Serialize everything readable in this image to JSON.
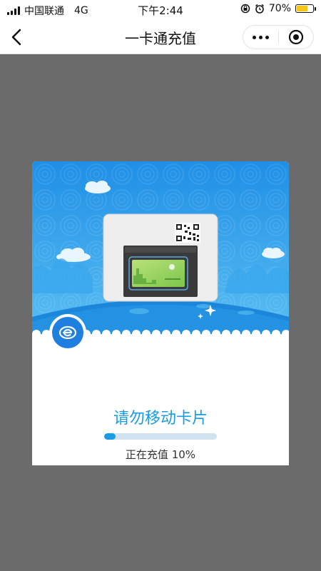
{
  "status_bar": {
    "carrier": "中国联通",
    "network": "4G",
    "time": "下午2:44",
    "battery_percent_text": "70%",
    "battery_level": 0.7
  },
  "nav": {
    "title": "一卡通充值",
    "back_icon": "chevron-left-icon",
    "more_icon": "more-dots-icon",
    "close_icon": "target-circle-icon"
  },
  "recharge": {
    "message": "请勿移动卡片",
    "progress_label": "正在充值",
    "progress_value": "10%",
    "progress_fraction": 0.1
  },
  "colors": {
    "accent": "#1a9be6",
    "sky": "#2a9ee8",
    "battery": "#f5c518"
  }
}
